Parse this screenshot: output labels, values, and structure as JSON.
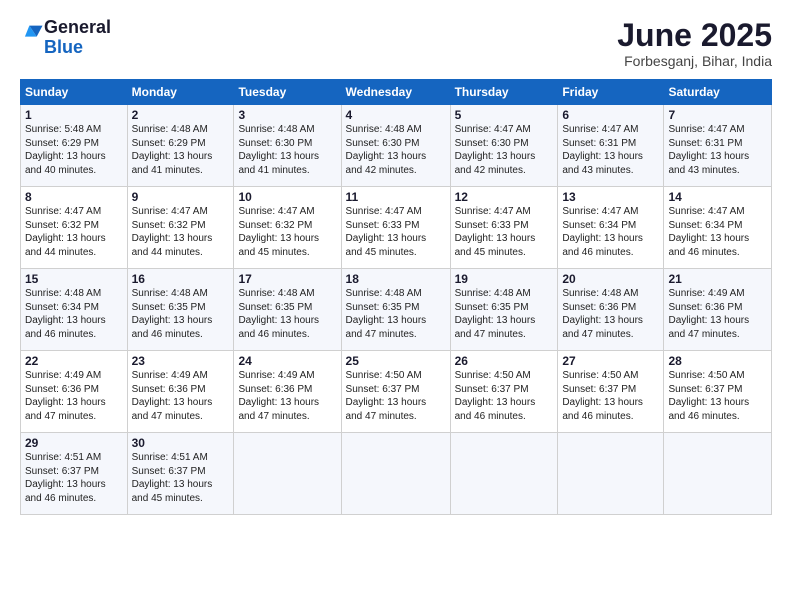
{
  "logo": {
    "general": "General",
    "blue": "Blue"
  },
  "title": "June 2025",
  "location": "Forbesganj, Bihar, India",
  "weekdays": [
    "Sunday",
    "Monday",
    "Tuesday",
    "Wednesday",
    "Thursday",
    "Friday",
    "Saturday"
  ],
  "weeks": [
    [
      {
        "day": 1,
        "sunrise": "5:48 AM",
        "sunset": "6:29 PM",
        "daylight": "13 hours and 40 minutes."
      },
      {
        "day": 2,
        "sunrise": "4:48 AM",
        "sunset": "6:29 PM",
        "daylight": "13 hours and 41 minutes."
      },
      {
        "day": 3,
        "sunrise": "4:48 AM",
        "sunset": "6:30 PM",
        "daylight": "13 hours and 41 minutes."
      },
      {
        "day": 4,
        "sunrise": "4:48 AM",
        "sunset": "6:30 PM",
        "daylight": "13 hours and 42 minutes."
      },
      {
        "day": 5,
        "sunrise": "4:47 AM",
        "sunset": "6:30 PM",
        "daylight": "13 hours and 42 minutes."
      },
      {
        "day": 6,
        "sunrise": "4:47 AM",
        "sunset": "6:31 PM",
        "daylight": "13 hours and 43 minutes."
      },
      {
        "day": 7,
        "sunrise": "4:47 AM",
        "sunset": "6:31 PM",
        "daylight": "13 hours and 43 minutes."
      }
    ],
    [
      {
        "day": 8,
        "sunrise": "4:47 AM",
        "sunset": "6:32 PM",
        "daylight": "13 hours and 44 minutes."
      },
      {
        "day": 9,
        "sunrise": "4:47 AM",
        "sunset": "6:32 PM",
        "daylight": "13 hours and 44 minutes."
      },
      {
        "day": 10,
        "sunrise": "4:47 AM",
        "sunset": "6:32 PM",
        "daylight": "13 hours and 45 minutes."
      },
      {
        "day": 11,
        "sunrise": "4:47 AM",
        "sunset": "6:33 PM",
        "daylight": "13 hours and 45 minutes."
      },
      {
        "day": 12,
        "sunrise": "4:47 AM",
        "sunset": "6:33 PM",
        "daylight": "13 hours and 45 minutes."
      },
      {
        "day": 13,
        "sunrise": "4:47 AM",
        "sunset": "6:34 PM",
        "daylight": "13 hours and 46 minutes."
      },
      {
        "day": 14,
        "sunrise": "4:47 AM",
        "sunset": "6:34 PM",
        "daylight": "13 hours and 46 minutes."
      }
    ],
    [
      {
        "day": 15,
        "sunrise": "4:48 AM",
        "sunset": "6:34 PM",
        "daylight": "13 hours and 46 minutes."
      },
      {
        "day": 16,
        "sunrise": "4:48 AM",
        "sunset": "6:35 PM",
        "daylight": "13 hours and 46 minutes."
      },
      {
        "day": 17,
        "sunrise": "4:48 AM",
        "sunset": "6:35 PM",
        "daylight": "13 hours and 46 minutes."
      },
      {
        "day": 18,
        "sunrise": "4:48 AM",
        "sunset": "6:35 PM",
        "daylight": "13 hours and 47 minutes."
      },
      {
        "day": 19,
        "sunrise": "4:48 AM",
        "sunset": "6:35 PM",
        "daylight": "13 hours and 47 minutes."
      },
      {
        "day": 20,
        "sunrise": "4:48 AM",
        "sunset": "6:36 PM",
        "daylight": "13 hours and 47 minutes."
      },
      {
        "day": 21,
        "sunrise": "4:49 AM",
        "sunset": "6:36 PM",
        "daylight": "13 hours and 47 minutes."
      }
    ],
    [
      {
        "day": 22,
        "sunrise": "4:49 AM",
        "sunset": "6:36 PM",
        "daylight": "13 hours and 47 minutes."
      },
      {
        "day": 23,
        "sunrise": "4:49 AM",
        "sunset": "6:36 PM",
        "daylight": "13 hours and 47 minutes."
      },
      {
        "day": 24,
        "sunrise": "4:49 AM",
        "sunset": "6:36 PM",
        "daylight": "13 hours and 47 minutes."
      },
      {
        "day": 25,
        "sunrise": "4:50 AM",
        "sunset": "6:37 PM",
        "daylight": "13 hours and 47 minutes."
      },
      {
        "day": 26,
        "sunrise": "4:50 AM",
        "sunset": "6:37 PM",
        "daylight": "13 hours and 46 minutes."
      },
      {
        "day": 27,
        "sunrise": "4:50 AM",
        "sunset": "6:37 PM",
        "daylight": "13 hours and 46 minutes."
      },
      {
        "day": 28,
        "sunrise": "4:50 AM",
        "sunset": "6:37 PM",
        "daylight": "13 hours and 46 minutes."
      }
    ],
    [
      {
        "day": 29,
        "sunrise": "4:51 AM",
        "sunset": "6:37 PM",
        "daylight": "13 hours and 46 minutes."
      },
      {
        "day": 30,
        "sunrise": "4:51 AM",
        "sunset": "6:37 PM",
        "daylight": "13 hours and 45 minutes."
      },
      null,
      null,
      null,
      null,
      null
    ]
  ]
}
